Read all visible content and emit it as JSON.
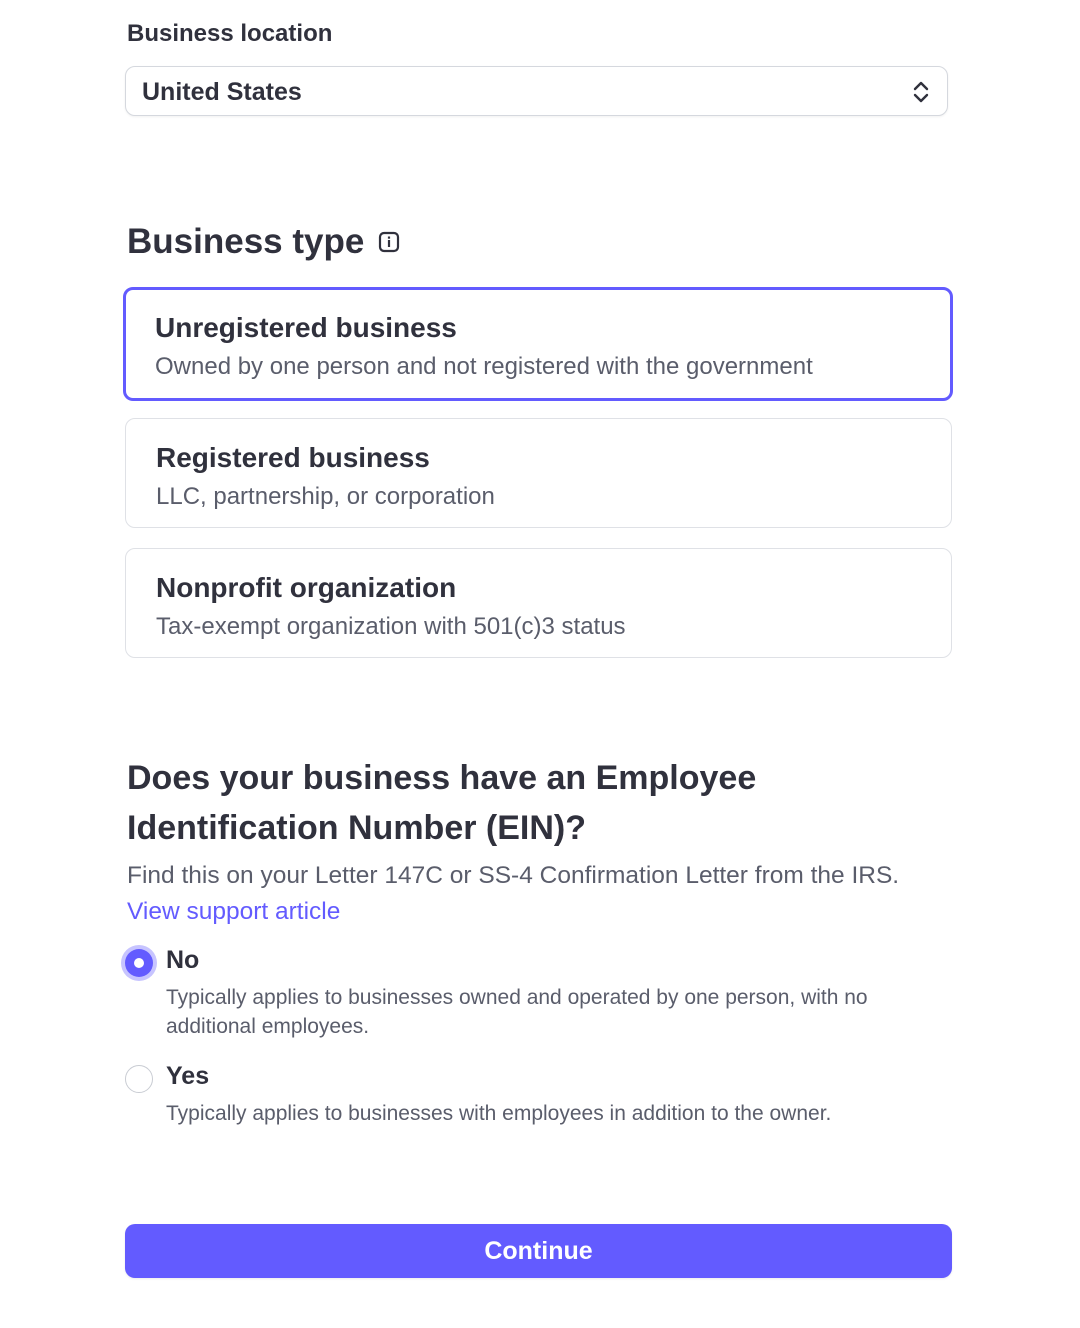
{
  "business_location": {
    "label": "Business location",
    "selected_value": "United States",
    "chevron_icon": "select-chevron-up-down-icon"
  },
  "business_type": {
    "heading": "Business type",
    "info_icon": "info-icon",
    "accent_color": "#635bff",
    "options": [
      {
        "title": "Unregistered business",
        "description": "Owned by one person and not registered with the government",
        "selected": true
      },
      {
        "title": "Registered business",
        "description": "LLC, partnership, or corporation",
        "selected": false
      },
      {
        "title": "Nonprofit organization",
        "description": "Tax-exempt organization with 501(c)3 status",
        "selected": false
      }
    ]
  },
  "ein": {
    "heading": "Does your business have an Employee Identification Number (EIN)?",
    "help_text": "Find this on your Letter 147C or SS-4 Confirmation Letter from the IRS.",
    "support_link": "View support article",
    "options": [
      {
        "label": "No",
        "description": "Typically applies to businesses owned and operated by one person, with no additional employees.",
        "checked": true
      },
      {
        "label": "Yes",
        "description": "Typically applies to businesses with employees in addition to the owner.",
        "checked": false
      }
    ]
  },
  "continue_button": {
    "label": "Continue",
    "color": "#635bff"
  }
}
